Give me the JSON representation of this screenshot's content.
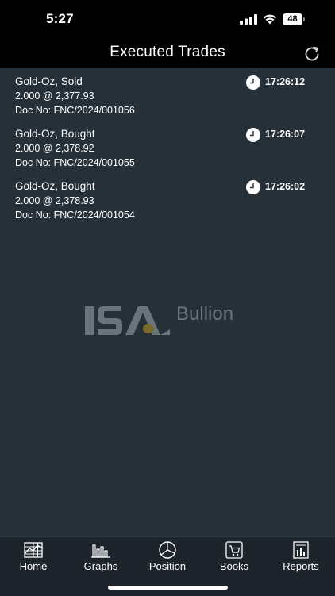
{
  "status_bar": {
    "time": "5:27",
    "battery": "48"
  },
  "header": {
    "title": "Executed Trades",
    "refresh_icon": "refresh-icon"
  },
  "trades": [
    {
      "instrument": "Gold-Oz, Sold",
      "qty_price": "2.000  @ 2,377.93",
      "doc": "Doc No:  FNC/2024/001056",
      "time": "17:26:12"
    },
    {
      "instrument": "Gold-Oz, Bought",
      "qty_price": "2.000  @ 2,378.92",
      "doc": "Doc No:  FNC/2024/001055",
      "time": "17:26:07"
    },
    {
      "instrument": "Gold-Oz, Bought",
      "qty_price": "2.000  @ 2,378.93",
      "doc": "Doc No:  FNC/2024/001054",
      "time": "17:26:02"
    }
  ],
  "logo": {
    "mark": "ISA",
    "text": "Bullion"
  },
  "nav": {
    "items": [
      {
        "label": "Home",
        "icon": "grid-chart-icon"
      },
      {
        "label": "Graphs",
        "icon": "bar-chart-icon"
      },
      {
        "label": "Position",
        "icon": "pie-chart-icon"
      },
      {
        "label": "Books",
        "icon": "cart-icon"
      },
      {
        "label": "Reports",
        "icon": "report-icon"
      }
    ]
  },
  "colors": {
    "background": "#263039",
    "header": "#000000",
    "nav_background": "#1d242b",
    "text": "#ffffff",
    "logo_gray": "#6c747b",
    "logo_accent": "#7a6a2e"
  }
}
